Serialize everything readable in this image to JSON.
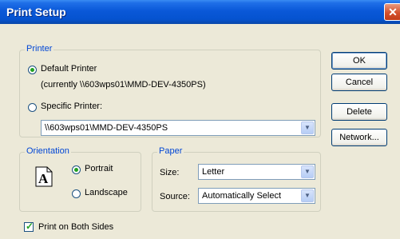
{
  "window": {
    "title": "Print Setup"
  },
  "printer": {
    "group_label": "Printer",
    "default_label": "Default Printer",
    "default_status": "(currently \\\\603wps01\\MMD-DEV-4350PS)",
    "specific_label": "Specific Printer:",
    "specific_value": "\\\\603wps01\\MMD-DEV-4350PS"
  },
  "orientation": {
    "group_label": "Orientation",
    "portrait": "Portrait",
    "landscape": "Landscape",
    "selected": "Portrait"
  },
  "paper": {
    "group_label": "Paper",
    "size_label": "Size:",
    "size_value": "Letter",
    "source_label": "Source:",
    "source_value": "Automatically Select"
  },
  "duplex": {
    "label": "Print on Both Sides",
    "checked": true
  },
  "buttons": {
    "ok": "OK",
    "cancel": "Cancel",
    "delete": "Delete",
    "network": "Network..."
  },
  "colors": {
    "title_bar": "#0553d0",
    "dialog_bg": "#ece9d8",
    "group_label": "#0046d5",
    "radio_selected": "#21a121"
  }
}
